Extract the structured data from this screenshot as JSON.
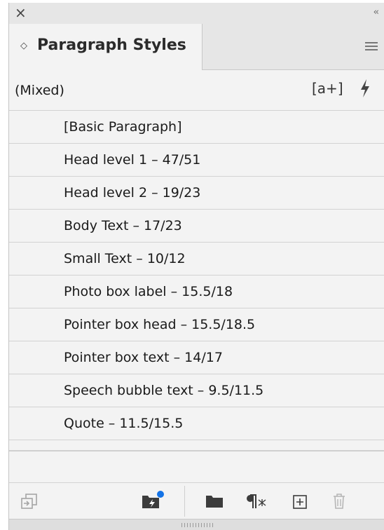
{
  "panel": {
    "title": "Paragraph Styles",
    "close_glyph": "×",
    "collapse_glyph": "‹‹",
    "tab_arrows_glyph": "◇"
  },
  "current": {
    "label": "(Mixed)",
    "new_style_glyph": "[a+]"
  },
  "styles": [
    "[Basic Paragraph]",
    "Head level 1 – 47/51",
    "Head level 2 – 19/23",
    "Body Text – 17/23",
    "Small Text – 10/12",
    "Photo box label – 15.5/18",
    "Pointer box head – 15.5/18.5",
    "Pointer box text – 14/17",
    "Speech bubble text – 9.5/11.5",
    "Quote – 11.5/15.5"
  ],
  "toolbar": {
    "items": [
      "load-styles-icon",
      "quick-apply-folder-icon",
      "folder-icon",
      "clear-overrides-icon",
      "new-style-icon",
      "trash-icon"
    ],
    "accent_dot_color": "#1473e6"
  }
}
